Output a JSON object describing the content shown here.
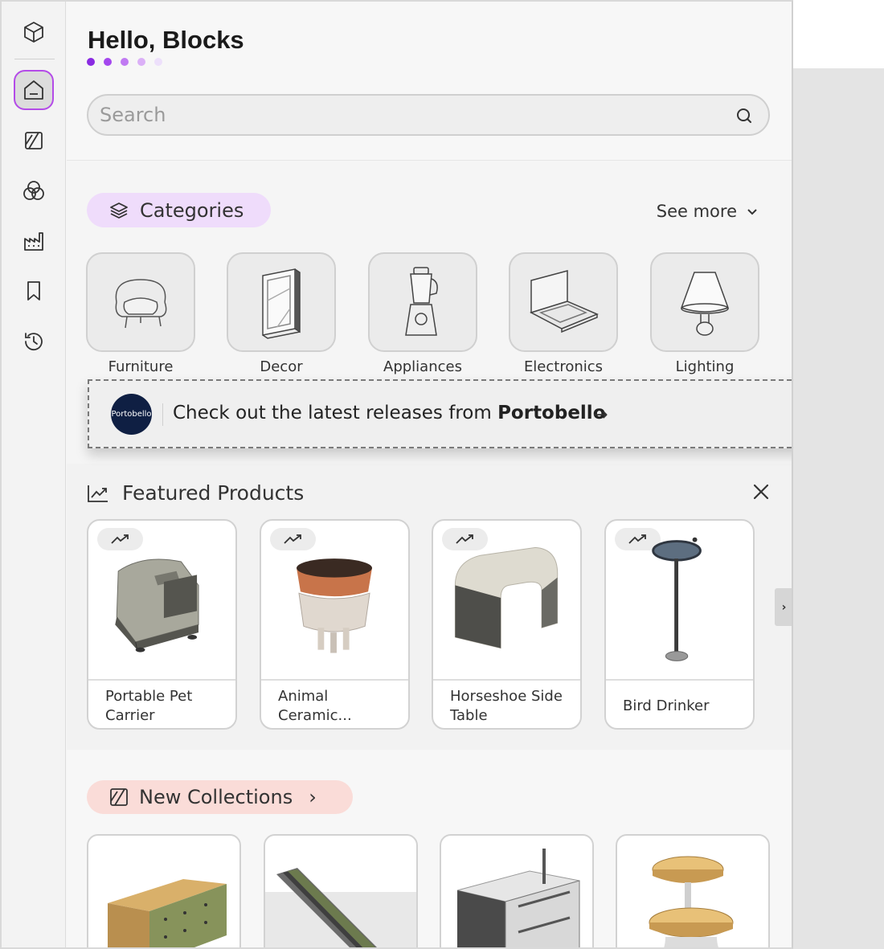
{
  "sidebar": {
    "items": [
      {
        "icon": "cube-logo-icon"
      },
      {
        "icon": "home-icon",
        "active": true
      },
      {
        "icon": "collections-icon"
      },
      {
        "icon": "materials-icon"
      },
      {
        "icon": "manufacturers-icon"
      },
      {
        "icon": "bookmark-icon"
      },
      {
        "icon": "history-icon"
      }
    ]
  },
  "header": {
    "greeting": "Hello, Blocks",
    "dots": [
      "#8a2be2",
      "#a447ee",
      "#c07af2",
      "#dbb0f7",
      "#ede0fb"
    ]
  },
  "search": {
    "placeholder": "Search",
    "value": ""
  },
  "categories": {
    "title": "Categories",
    "see_more": "See more",
    "items": [
      {
        "label": "Furniture"
      },
      {
        "label": "Decor"
      },
      {
        "label": "Appliances"
      },
      {
        "label": "Electronics"
      },
      {
        "label": "Lighting"
      }
    ]
  },
  "promo": {
    "brand_logo_text": "Portobello",
    "text_prefix": "Check out the latest releases from",
    "brand": "Portobello",
    "arrow": "→"
  },
  "featured": {
    "title": "Featured Products",
    "products": [
      {
        "name": "Portable Pet Carrier"
      },
      {
        "name": "Animal Ceramic..."
      },
      {
        "name": "Horseshoe Side Table"
      },
      {
        "name": "Bird Drinker"
      }
    ],
    "next": "›"
  },
  "collections": {
    "title": "New Collections",
    "chevron": "›"
  },
  "colors": {
    "accent": "#b44be8",
    "categories_pill": "#efdcfb",
    "collections_pill": "#fadcd8"
  }
}
